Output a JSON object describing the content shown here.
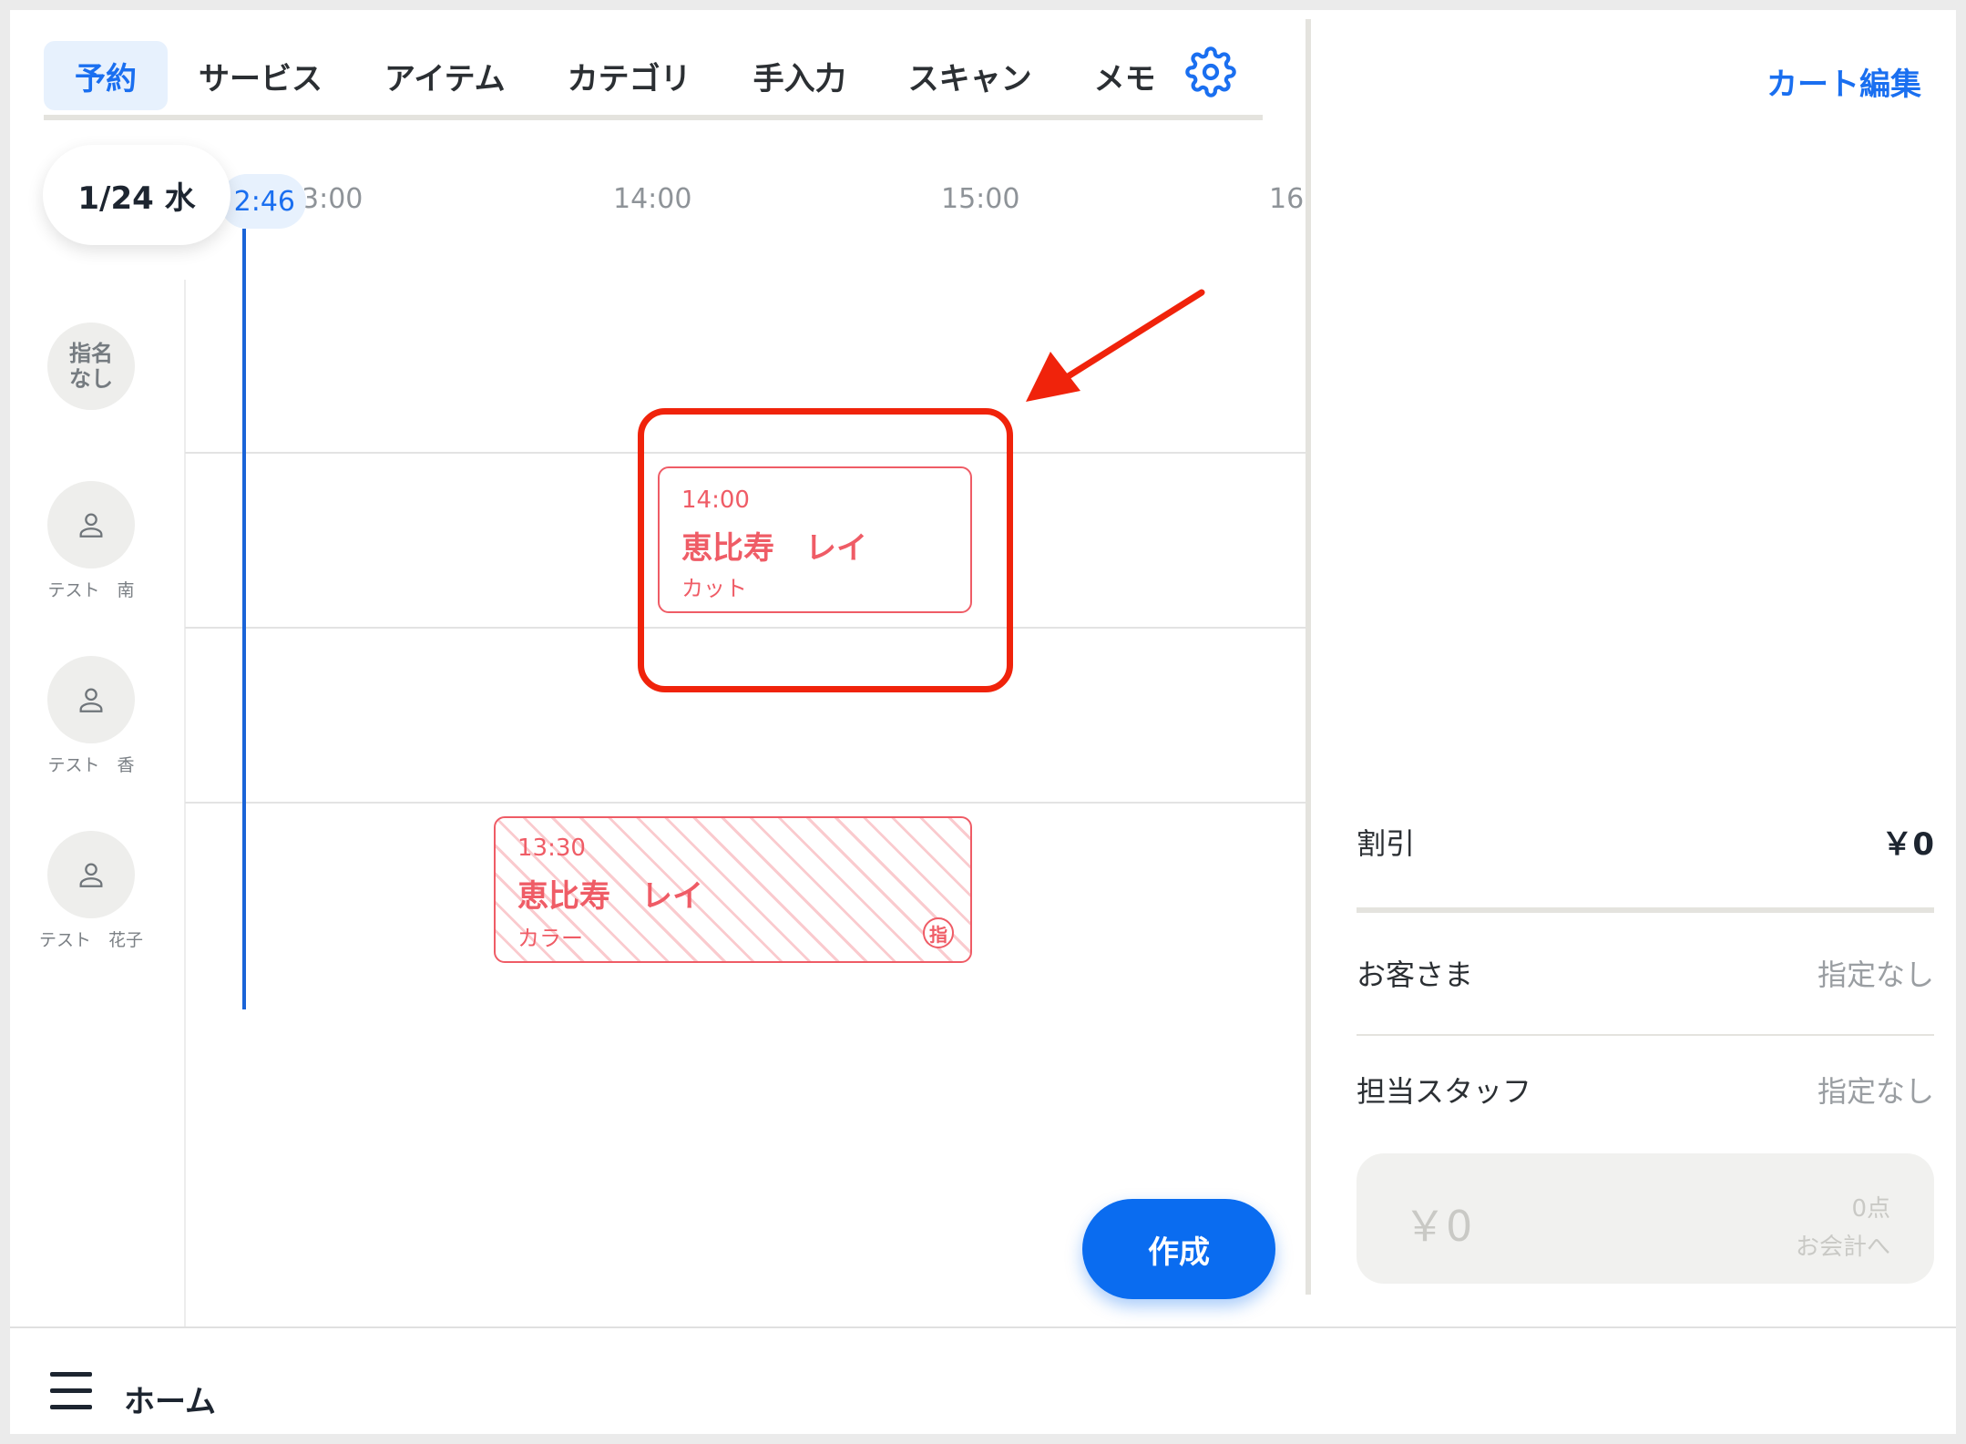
{
  "tabs": [
    {
      "label": "予約",
      "active": true
    },
    {
      "label": "サービス"
    },
    {
      "label": "アイテム"
    },
    {
      "label": "カテゴリ"
    },
    {
      "label": "手入力"
    },
    {
      "label": "スキャン"
    },
    {
      "label": "メモ"
    }
  ],
  "settings_icon": "gear-icon",
  "timeline": {
    "date": "1/24 水",
    "now": "2:46",
    "hours": [
      "3:00",
      "14:00",
      "15:00",
      "16:"
    ]
  },
  "staff": [
    {
      "label": "指名\nなし",
      "icon": "none"
    },
    {
      "label": "テスト　南",
      "icon": "person-icon"
    },
    {
      "label": "テスト　香",
      "icon": "person-icon"
    },
    {
      "label": "テスト　花子",
      "icon": "person-icon"
    }
  ],
  "appointments": [
    {
      "time": "14:00",
      "customer": "恵比寿　レイ",
      "service": "カット",
      "hatched": false
    },
    {
      "time": "13:30",
      "customer": "恵比寿　レイ",
      "service": "カラー",
      "hatched": true,
      "badge": "指"
    }
  ],
  "create_button": "作成",
  "cart": {
    "edit_label": "カート編集",
    "discount_label": "割引",
    "discount_value": "￥0",
    "customer_label": "お客さま",
    "customer_value": "指定なし",
    "staff_label": "担当スタッフ",
    "staff_value": "指定なし",
    "checkout_amount": "￥0",
    "checkout_count": "0点",
    "checkout_label": "お会計へ"
  },
  "bottom": {
    "home_label": "ホーム"
  },
  "colors": {
    "accent": "#1a6ff0",
    "appointment": "#ef5c66",
    "highlight": "#f0230b"
  }
}
